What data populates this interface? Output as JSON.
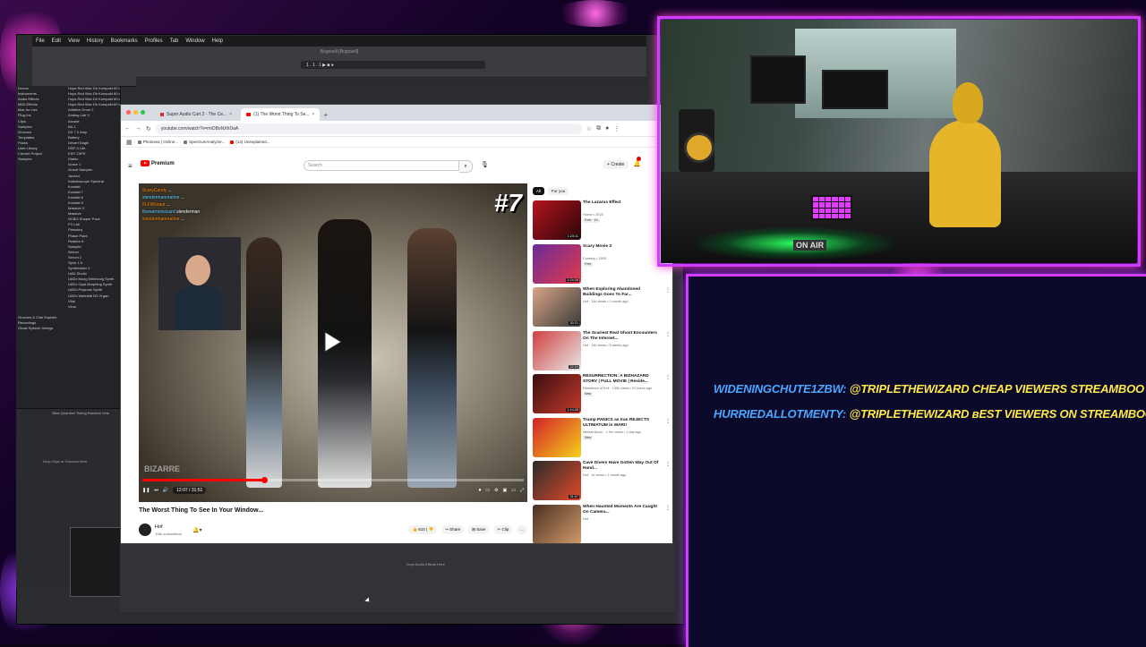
{
  "menubar": [
    "File",
    "Edit",
    "View",
    "History",
    "Bookmarks",
    "Profiles",
    "Tab",
    "Window",
    "Help"
  ],
  "daw": {
    "title": "Bogosell [Bogosell]",
    "transport": "1 . 1 . 1   ▶ ■ ●",
    "browser_left": [
      "Drums",
      "Instruments",
      "Audio Effects",
      "MIDI Effects",
      "Max for Live",
      "Plug-Ins",
      "Clips",
      "Samples",
      "Grooves",
      "Templates",
      "Packs",
      "User Library",
      "Current Project",
      "Samples",
      "",
      "",
      "",
      "",
      "",
      "",
      "",
      "",
      "",
      "",
      "",
      "",
      "",
      "",
      "",
      "",
      "",
      "",
      "",
      "",
      "",
      "",
      "",
      "",
      "",
      "",
      "",
      "",
      "Grooves & Club Exploits",
      "Recordings",
      "Ghost Speech Swings"
    ],
    "browser_right": [
      "Hops Red Wav Dlr Kompakt 60 waves",
      "Hops Red Wav Dlr Kompakt 60 waves",
      "Hops Red Wav Dlr Kompakt 60 waves",
      "Hops Red Wav Dlr Kompakt 60 waves",
      "Additive Drum 2",
      "Analog Lab V",
      "Arcade",
      "BA-1",
      "DX 7 II Amp",
      "Battery",
      "Desert Eagle",
      "DSP-4 Lite",
      "EXP-TAPE",
      "Diablo",
      "Grace 1",
      "Grand Sampler",
      "Jazzed",
      "Kaleidoscope Spectral",
      "Kontakt",
      "Kontakt 7",
      "Kontakt 8",
      "Kontakt 9",
      "Massive X",
      "Massive",
      "NCBO Shaper Pack",
      "FX Lab",
      "Pianoteq",
      "Phase Plant",
      "Reaktor 6",
      "Sampler",
      "Serum",
      "Serum 2",
      "Spire 1.5",
      "Synthesizer V",
      "UAD Studio",
      "UADx Moog Minimoog Synth",
      "UADx Opal Morphing Synth",
      "UADx Polymax Synth",
      "UADx Waterfall B3 Organ",
      "Vital",
      "Virus"
    ],
    "lower_tabs": "Slice   Quantize   Timing   Random   Velo",
    "drop_clips": "Drop Clips or Grooves Here",
    "drop_audio": "Drop Audio Effects Here"
  },
  "browser": {
    "tabs": [
      {
        "label": "Super Audio Cart 2 - The Ce...",
        "active": false
      },
      {
        "label": "(1) The Worst Thing To Se...",
        "active": true
      }
    ],
    "new_tab": "+",
    "url": "youtube.com/watch?v=rmDBoNXhDaA",
    "bookmarks": [
      "Photosea | Online...",
      "SpectrumAnalyzer...",
      "(14) Unexplained..."
    ]
  },
  "youtube": {
    "logo_text": "Premium",
    "search_placeholder": "Search",
    "create_label": "Create",
    "player": {
      "chat_lines": [
        {
          "user": "ScaryCandy",
          "text": "..."
        },
        {
          "user": "slendermanrealme",
          "text": "..."
        },
        {
          "user": "#LFWirzaut",
          "text": "..."
        },
        {
          "user": "thewarriorwizard",
          "text": "slenderman"
        },
        {
          "user": "slendermanrealme",
          "text": "..."
        }
      ],
      "episode": "#7",
      "watermark": "BIZARRE",
      "time": "12:07 / 31:51",
      "progress": 0.32
    },
    "video_title": "The Worst Thing To See In Your Window...",
    "channel": {
      "name": "Hof",
      "subs": "116k subscribers"
    },
    "actions": [
      "610",
      "Share",
      "Save",
      "Clip",
      "..."
    ],
    "chips": [
      "All",
      "For you"
    ],
    "recommendations": [
      {
        "title": "The Lazarus Effect",
        "meta": "Horror • 2015",
        "badge": "Free · 1h",
        "duration": "1:23:11",
        "colors": [
          "#b5141f",
          "#2a0608"
        ]
      },
      {
        "title": "Scary Movie 3",
        "meta": "Comedy • 2003",
        "badge": "Free",
        "duration": "1:24:28",
        "colors": [
          "#6b2b9a",
          "#e23a4a"
        ]
      },
      {
        "title": "When Exploring Abandoned Buildings Goes To Far...",
        "meta": "Hof · 14k views • 1 month ago",
        "badge": "",
        "duration": "30:21",
        "colors": [
          "#d9a585",
          "#3a3a3a"
        ]
      },
      {
        "title": "The Scariest Real Ghost Encounters On The Internet...",
        "meta": "Hof · 14k views • 3 weeks ago",
        "badge": "",
        "duration": "22:24",
        "colors": [
          "#d14040",
          "#e8e8e8"
        ]
      },
      {
        "title": "RESURRECTION: A BIZHAZARD STORY | FULL MOVIE | Reside...",
        "meta": "Residence of Evil · 143k views • 21 hours ago",
        "badge": "New",
        "duration": "1:14:28",
        "colors": [
          "#3a0e10",
          "#c43a2a"
        ]
      },
      {
        "title": "Trump PANICS as Iran REJECTS ULTIMATUM in WAR!!",
        "meta": "MeidasTouch · 1.9m views • 1 day ago",
        "badge": "New",
        "duration": "",
        "colors": [
          "#d4202a",
          "#f4d11a"
        ]
      },
      {
        "title": "Cave Divers Have Gotten Way Out Of Hand...",
        "meta": "Hof · 1k views • 1 month ago",
        "badge": "",
        "duration": "31:07",
        "colors": [
          "#2b2b2b",
          "#e04a2a"
        ]
      },
      {
        "title": "When Haunted Moments Are Caught On Camera...",
        "meta": "Hof",
        "badge": "",
        "duration": "",
        "colors": [
          "#4a3022",
          "#d19a6a"
        ]
      }
    ]
  },
  "webcam": {
    "sign": "ON AIR"
  },
  "chat": [
    {
      "user": "WIDENINGCHUTE1ZBW:",
      "msg": "@TRIPLETHEWIZARD CHEAP VIEWERS STREAMBOO .COM (R"
    },
    {
      "user": "HURRIEDALLOTMENTY:",
      "msg": "@TRIPLETHEWIZARD ʙEST VIEWERS ON STREAMBOO .COM"
    }
  ],
  "colors": {
    "neon": "#d23cff",
    "chat_user": "#4aa6ff",
    "chat_msg": "#ffe94a",
    "yt_red": "#ff0000"
  }
}
